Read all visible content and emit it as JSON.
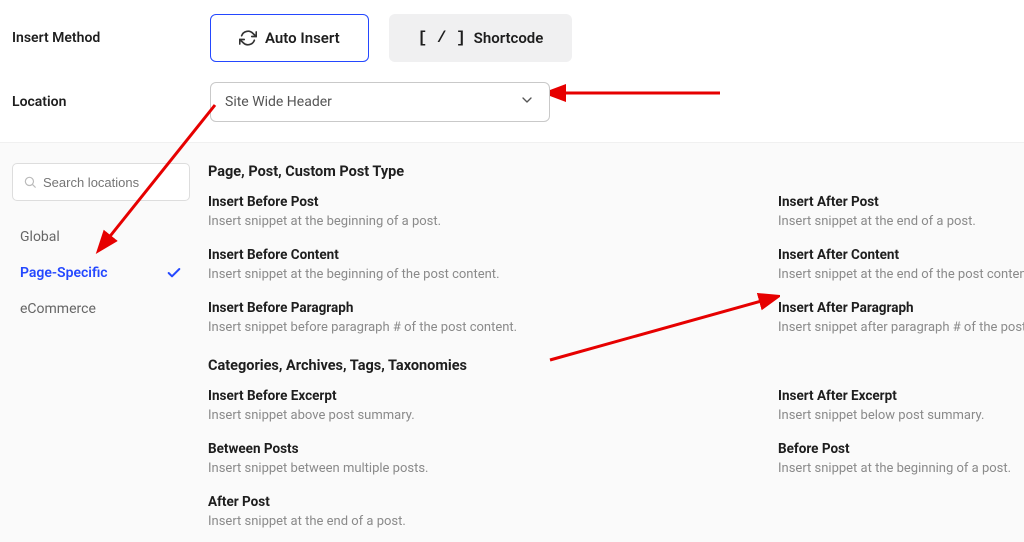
{
  "labels": {
    "insert_method": "Insert Method",
    "location": "Location"
  },
  "method_buttons": {
    "auto_insert": "Auto Insert",
    "shortcode": "Shortcode"
  },
  "location_select": {
    "value": "Site Wide Header"
  },
  "search": {
    "placeholder": "Search locations"
  },
  "categories": {
    "global": "Global",
    "page_specific": "Page-Specific",
    "ecommerce": "eCommerce"
  },
  "groups": {
    "ppcpt": {
      "heading": "Page, Post, Custom Post Type",
      "options": [
        {
          "title": "Insert Before Post",
          "desc": "Insert snippet at the beginning of a post."
        },
        {
          "title": "Insert After Post",
          "desc": "Insert snippet at the end of a post."
        },
        {
          "title": "Insert Before Content",
          "desc": "Insert snippet at the beginning of the post content."
        },
        {
          "title": "Insert After Content",
          "desc": "Insert snippet at the end of the post content."
        },
        {
          "title": "Insert Before Paragraph",
          "desc": "Insert snippet before paragraph # of the post content."
        },
        {
          "title": "Insert After Paragraph",
          "desc": "Insert snippet after paragraph # of the post content."
        }
      ]
    },
    "catt": {
      "heading": "Categories, Archives, Tags, Taxonomies",
      "options": [
        {
          "title": "Insert Before Excerpt",
          "desc": "Insert snippet above post summary."
        },
        {
          "title": "Insert After Excerpt",
          "desc": "Insert snippet below post summary."
        },
        {
          "title": "Between Posts",
          "desc": "Insert snippet between multiple posts."
        },
        {
          "title": "Before Post",
          "desc": "Insert snippet at the beginning of a post."
        },
        {
          "title": "After Post",
          "desc": "Insert snippet at the end of a post."
        }
      ]
    }
  }
}
